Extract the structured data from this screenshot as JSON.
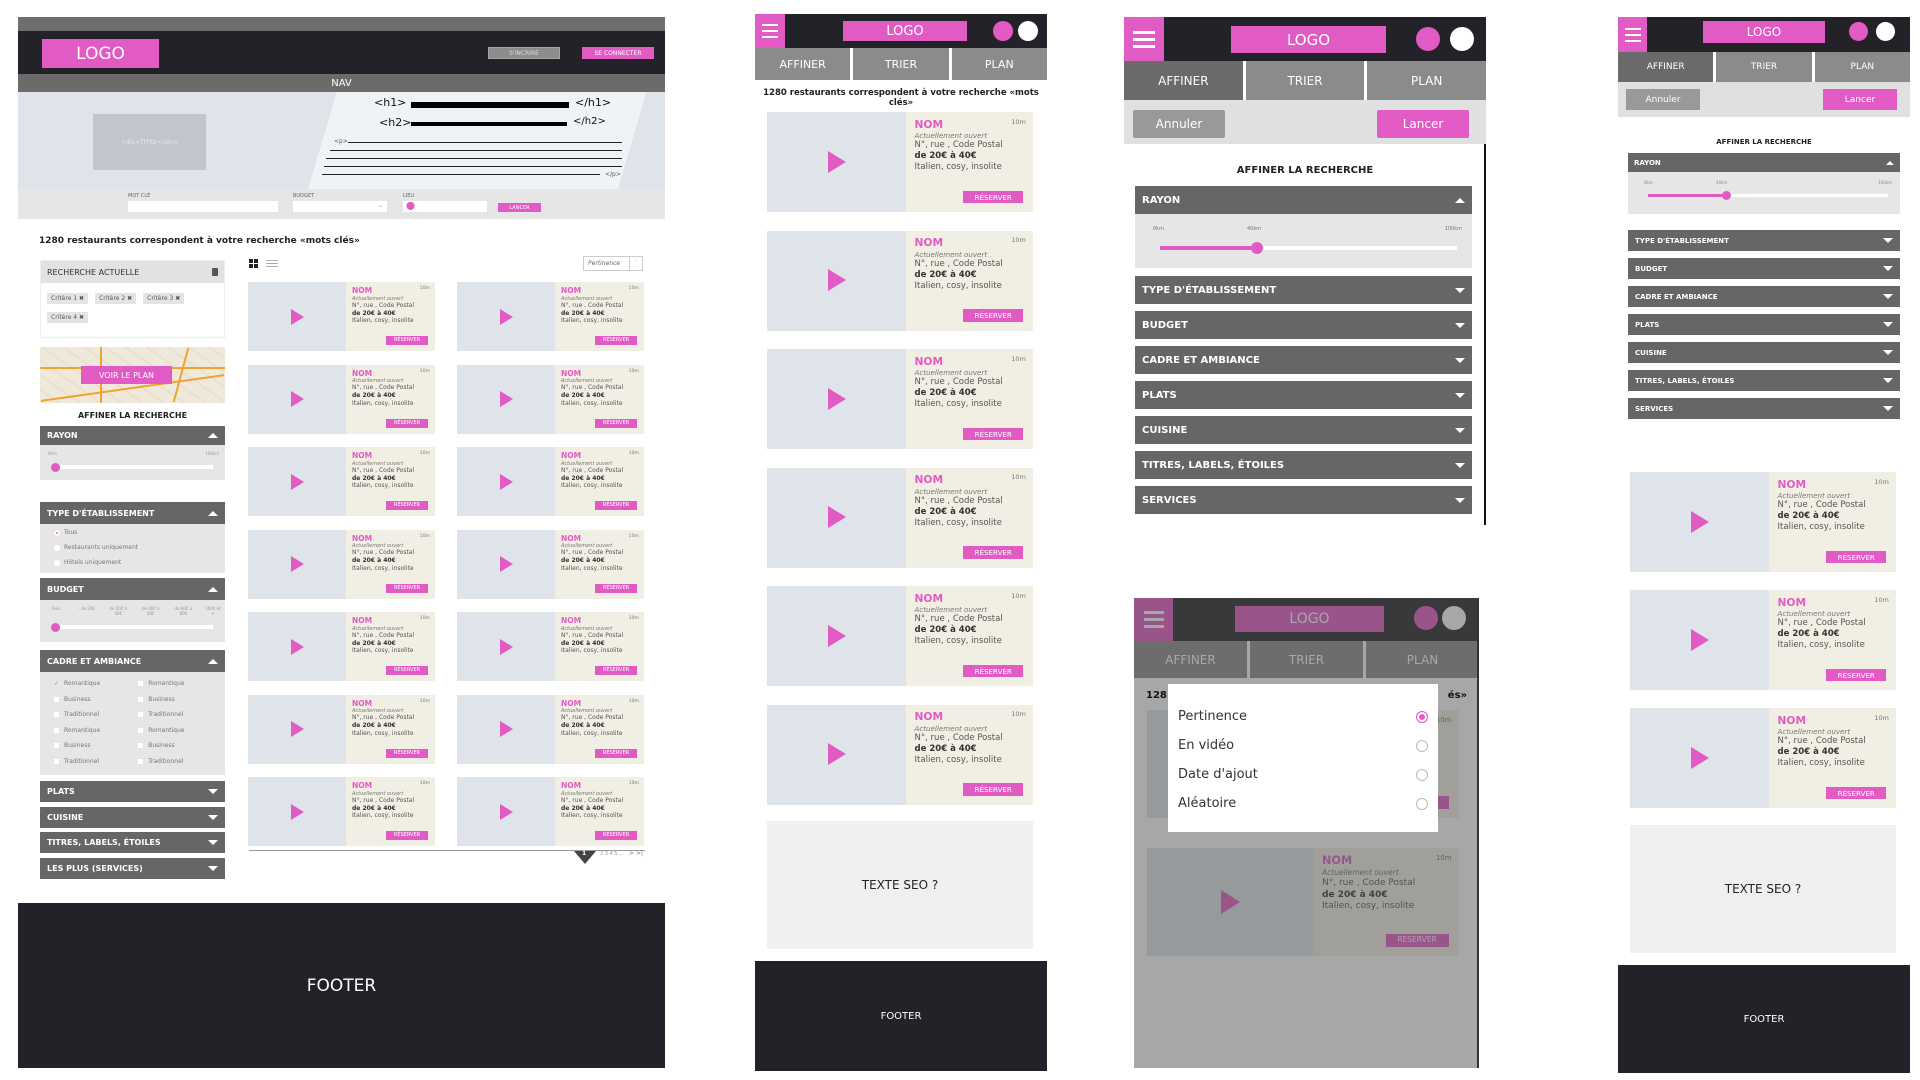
{
  "colors": {
    "accent": "#e25bc4",
    "header_bg": "#232228",
    "accordion_bg": "#666666",
    "card_bg": "#f1efe4",
    "media_bg": "#dfe4ea"
  },
  "desktop": {
    "logo": "LOGO",
    "signup": "S'INCRIRE",
    "login": "SE CONNECTER",
    "nav": "NAV",
    "hero": {
      "title_div": "<div>TITRE</div>",
      "h1_open": "<h1>",
      "h1_close": "</h1>",
      "h2_open": "<h2>",
      "h2_close": "</h2>",
      "p_open": "<p>",
      "p_close": "</p>"
    },
    "search": {
      "keyword_label": "MOT CLÉ",
      "keyword_value": "",
      "budget_label": "BUDGET",
      "budget_value": "",
      "place_label": "LIEU",
      "place_value": "",
      "submit": "LANCER"
    },
    "results_count": "1280 restaurants correspondent à votre recherche «mots clés»",
    "current_search": {
      "title": "RECHERCHE ACTUELLE",
      "criteria": [
        "Critère 1",
        "Critère 2",
        "Critère 3",
        "Critère 4"
      ]
    },
    "map_button": "VOIR LE PLAN",
    "refine_title": "AFFINER LA RECHERCHE",
    "rayon": {
      "title": "RAYON",
      "min": "0km",
      "max": "100km",
      "value_pct": 0
    },
    "type": {
      "title": "TYPE D'ÉTABLISSEMENT",
      "options": [
        "Tous",
        "Restaurants uniquement",
        "Hôtels uniquement"
      ],
      "selected": 0
    },
    "budget": {
      "title": "BUDGET",
      "ticks": [
        "Tous",
        "- de 20€",
        "de 20€ à 40€",
        "de 40€ à 60€",
        "de 60€ à 80€",
        "100€ et +"
      ],
      "value_index": 0
    },
    "cadre": {
      "title": "CADRE ET AMBIANCE",
      "col1": [
        "Romantique",
        "Business",
        "Traditionnel",
        "Romantique",
        "Business",
        "Traditionnel"
      ],
      "col2": [
        "Romantique",
        "Business",
        "Traditionnel",
        "Romantique",
        "Business",
        "Traditionnel"
      ],
      "checked": "col1-0"
    },
    "collapsed": [
      "PLATS",
      "CUISINE",
      "TITRES, LABELS, ÉTOILES",
      "LES PLUS (SERVICES)"
    ],
    "sort_value": "Pertinence",
    "pagination": {
      "current": "1",
      "pages": "2 3 4 5 ...",
      "next": ">",
      "last": ">|"
    },
    "footer": "FOOTER"
  },
  "card": {
    "name": "NOM",
    "distance": "10m",
    "status": "Actuellement ouvert",
    "address": "N°, rue , Code Postal",
    "price": "de 20€ à 40€",
    "tags": "Italien, cosy, insolite",
    "book": "RÉSERVER"
  },
  "mobile": {
    "logo": "LOGO",
    "tabs": [
      "AFFINER",
      "TRIER",
      "PLAN"
    ],
    "results_count": "1280 restaurants correspondent à votre recherche «mots clés»",
    "seo": "TEXTE SEO ?",
    "footer": "FOOTER",
    "cancel": "Annuler",
    "apply": "Lancer",
    "refine_title": "AFFINER LA RECHERCHE",
    "rayon": {
      "title": "RAYON",
      "min": "0km",
      "mid": "40km",
      "max": "100km",
      "value_km": 40
    },
    "filters": [
      "TYPE D'ÉTABLISSEMENT",
      "BUDGET",
      "CADRE ET AMBIANCE",
      "PLATS",
      "CUISINE",
      "TITRES, LABELS, ÉTOILES",
      "SERVICES"
    ],
    "sort": {
      "options": [
        "Pertinence",
        "En vidéo",
        "Date d'ajout",
        "Aléatoire"
      ],
      "selected": 0,
      "partial_left": "128",
      "partial_right": "és»"
    }
  }
}
